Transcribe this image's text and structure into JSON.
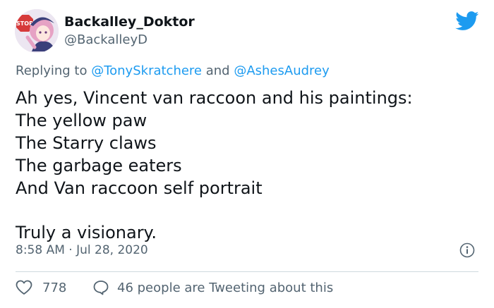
{
  "user": {
    "name": "Backalley_Doktor",
    "handle": "@BackalleyD",
    "avatar_icon": "anime-character-avatar",
    "avatar_sign_text": "STOP"
  },
  "twitter_icon": "twitter-bird-icon",
  "reply": {
    "prefix": "Replying to ",
    "mention_1": "@TonySkratchere",
    "connector": " and ",
    "mention_2": "@AshesAudrey"
  },
  "tweet": {
    "lines": [
      "Ah yes, Vincent van raccoon and his paintings:",
      "The yellow paw",
      "The Starry claws",
      "The garbage eaters",
      "And Van raccoon self portrait",
      "Truly a visionary."
    ]
  },
  "timestamp": "8:58 AM · Jul 28, 2020",
  "footer": {
    "likes": "778",
    "talking": "46 people are Tweeting about this"
  },
  "colors": {
    "accent": "#1d9bf0",
    "secondary_text": "#536471",
    "primary_text": "#0f1419",
    "heart": "#e0245e"
  }
}
